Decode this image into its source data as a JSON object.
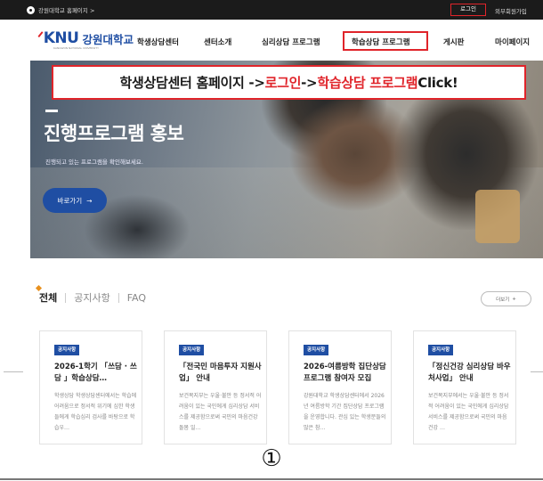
{
  "topbar": {
    "home_link": "강원대학교 홈페이지 >",
    "login": "로그인",
    "external_join": "외부회원가입"
  },
  "header": {
    "logo_knu": "KNU",
    "logo_korean": "강원대학교",
    "logo_sub": "KANGWON NATIONAL UNIVERSITY",
    "nav": [
      {
        "label": "학생상담센터"
      },
      {
        "label": "센터소개"
      },
      {
        "label": "심리상담 프로그램"
      },
      {
        "label": "학습상담 프로그램"
      },
      {
        "label": "게시판"
      },
      {
        "label": "마이페이지"
      }
    ]
  },
  "hero": {
    "title": "진행프로그램 홍보",
    "description": "진행되고 있는 프로그램을 확인해보세요.",
    "button": "바로가기",
    "button_arrow": "→"
  },
  "instruction": {
    "part1": "학생상담센터 홈페이지 -> ",
    "part2": "로그인",
    "part3": " -> ",
    "part4": "학습상담 프로그램",
    "part5": " Click!"
  },
  "board": {
    "tabs": [
      "전체",
      "공지사항",
      "FAQ"
    ],
    "more": "더보기",
    "more_icon": "+",
    "cards": [
      {
        "badge": "공지사항",
        "title": "2026-1학기 「쓰담 · 쓰담 」학습상담…",
        "body": "학생상담 학생상담센터에서는 학습에 어려움으로 정서적 위기에 심한 학생들에게 학습심리 검사를 바탕으로 학습우…"
      },
      {
        "badge": "공지사항",
        "title": "「전국민 마음투자 지원사업」 안내",
        "body": "보건복지부는 우울·불안 등 정서적 어려움이 있는 국민에게 심리상담 서비스를 제공함으로써 국민의 마음건강 돌봄 일…"
      },
      {
        "badge": "공지사항",
        "title": "2026-여름방학 집단상담 프로그램 참여자 모집",
        "body": "강원대학교 학생상담센터에서 2026년 여름방학 기간 집단상담 프로그램을 운영합니다. 관심 있는 학생분들의 많은 참…"
      },
      {
        "badge": "공지사항",
        "title": "「정신건강 심리상담 바우처사업」 안내",
        "body": "보건복지부에서는 우울·불안 등 정서적 어려움이 있는 국민에게 심리상담 서비스를 제공함으로써 국민의 마음건강 …"
      }
    ]
  },
  "footer_marker": "①",
  "colors": {
    "accent_red": "#e0242a",
    "brand_blue": "#1f4ea3",
    "topbar_bg": "#1b1b1b"
  }
}
